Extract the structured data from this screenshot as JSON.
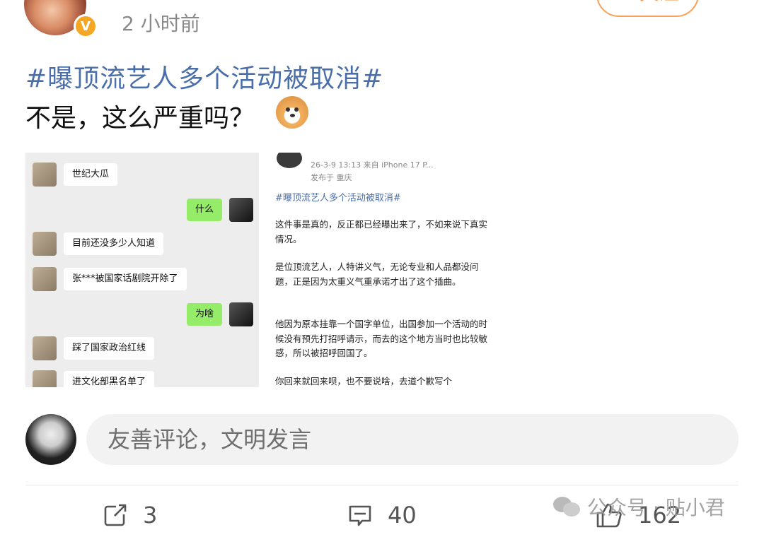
{
  "post": {
    "time": "2 小时前",
    "follow_label": "+ 关注",
    "hashtag": "#曝顶流艺人多个活动被取消#",
    "text": "不是，这么严重吗？"
  },
  "chat": [
    {
      "side": "left",
      "text": "世纪大瓜"
    },
    {
      "side": "right",
      "text": "什么"
    },
    {
      "side": "left",
      "text": "目前还没多少人知道"
    },
    {
      "side": "left",
      "text": "张***被国家话剧院开除了"
    },
    {
      "side": "right",
      "text": "为啥"
    },
    {
      "side": "left",
      "text": "踩了国家政治红线"
    },
    {
      "side": "left",
      "text": "进文化部黑名单了"
    }
  ],
  "embedded_post": {
    "meta_line": "26-3-9 13:13  来自 iPhone 17 P...",
    "location": "发布于 重庆",
    "hashtag": "#曝顶流艺人多个活动被取消#",
    "paragraphs": [
      "这件事是真的，反正都已经曝出来了，不如来说下真实情况。",
      "是位顶流艺人，人特讲义气，无论专业和人品都没问题，正是因为太重义气重承诺才出了这个插曲。",
      "他因为原本挂靠一个国字单位，出国参加一个活动的时候没有预先打招呼请示，而去的这个地方当时也比较敏感，所以被招呼回国了。",
      "你回来就回来呗，也不要说啥，去道个歉写个"
    ]
  },
  "comment": {
    "placeholder": "友善评论，文明发言"
  },
  "actions": {
    "share_count": "3",
    "comment_count": "40",
    "like_count": "162"
  },
  "watermark": {
    "text": "公众号 · 贴小君"
  },
  "colors": {
    "hashtag": "#4a6ea9",
    "follow": "#f08a36",
    "chat_me": "#95ec69",
    "badge": "#f5a623"
  }
}
